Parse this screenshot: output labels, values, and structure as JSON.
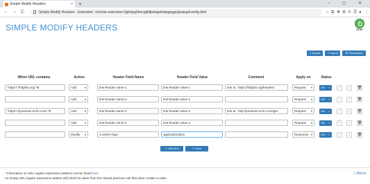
{
  "browser": {
    "tab_title": "Simple Modify Headers",
    "tab_close": "×",
    "new_tab": "+",
    "window_controls": "– ▢ ✕",
    "back": "←",
    "forward": "→",
    "reload": "C",
    "url_prefix": "Simple Modify Headers - Extended",
    "url_separator": " | ",
    "url": "chrome-extension://gbhjcghhecgljidfpoegebnkpgoggcj/popup/config.html",
    "ext_icons": [
      "☆",
      "⧉",
      "✥",
      "⚙",
      "↻",
      "☰",
      "●",
      "⋮"
    ]
  },
  "header": {
    "title": "SIMPLE MODIFY HEADERS",
    "stop_label": "STOP"
  },
  "toolbar": {
    "export_label": "Export",
    "import_label": "Import",
    "parameters_label": "Parameters"
  },
  "table": {
    "columns": [
      "When URL contains",
      "Action",
      "Header Field Name",
      "Header Field Value",
      "Comment",
      "Apply on",
      "Status"
    ],
    "rows": [
      {
        "url": "^https?://httpbin.org/.*$",
        "action": "Add",
        "name": "test-header-name-1",
        "value": "test-header-value-1",
        "comment": "test at : https://httpbin.org/headers",
        "apply": "Request",
        "status": "ON"
      },
      {
        "url": "",
        "action": "Add",
        "name": "test-header-name-2",
        "value": "test-header-value-2",
        "comment": "",
        "apply": "Request",
        "status": "ON"
      },
      {
        "url": "^https?://postman-echo.com/.*$",
        "action": "Add",
        "name": "test-header-name-3",
        "value": "test-header-value-3",
        "comment": "test at : http://postman-echo.com/get",
        "apply": "Request",
        "status": "ON"
      },
      {
        "url": "",
        "action": "Add",
        "name": "test-header-name-4",
        "value": "test-header-value-4",
        "comment": "",
        "apply": "Request",
        "status": "ON"
      },
      {
        "url": "",
        "action": "Modify",
        "name": "Content-Type",
        "value": "application/json",
        "comment": "",
        "apply": "Response",
        "status": "ON"
      }
    ]
  },
  "actions": {
    "new_line_label": "New line",
    "save_label": "Save"
  },
  "footer": {
    "info_text": "* Information on URL regular expression patterns can be found ",
    "info_link": "here",
    "empty_note": "An empty URL regular expression pattern will inherit its value from the closest previous rule that does contain a value.",
    "about_label": "About"
  },
  "colors": {
    "accent": "#337ab7",
    "title": "#3d8fd1",
    "stop": "#5cb85c"
  }
}
